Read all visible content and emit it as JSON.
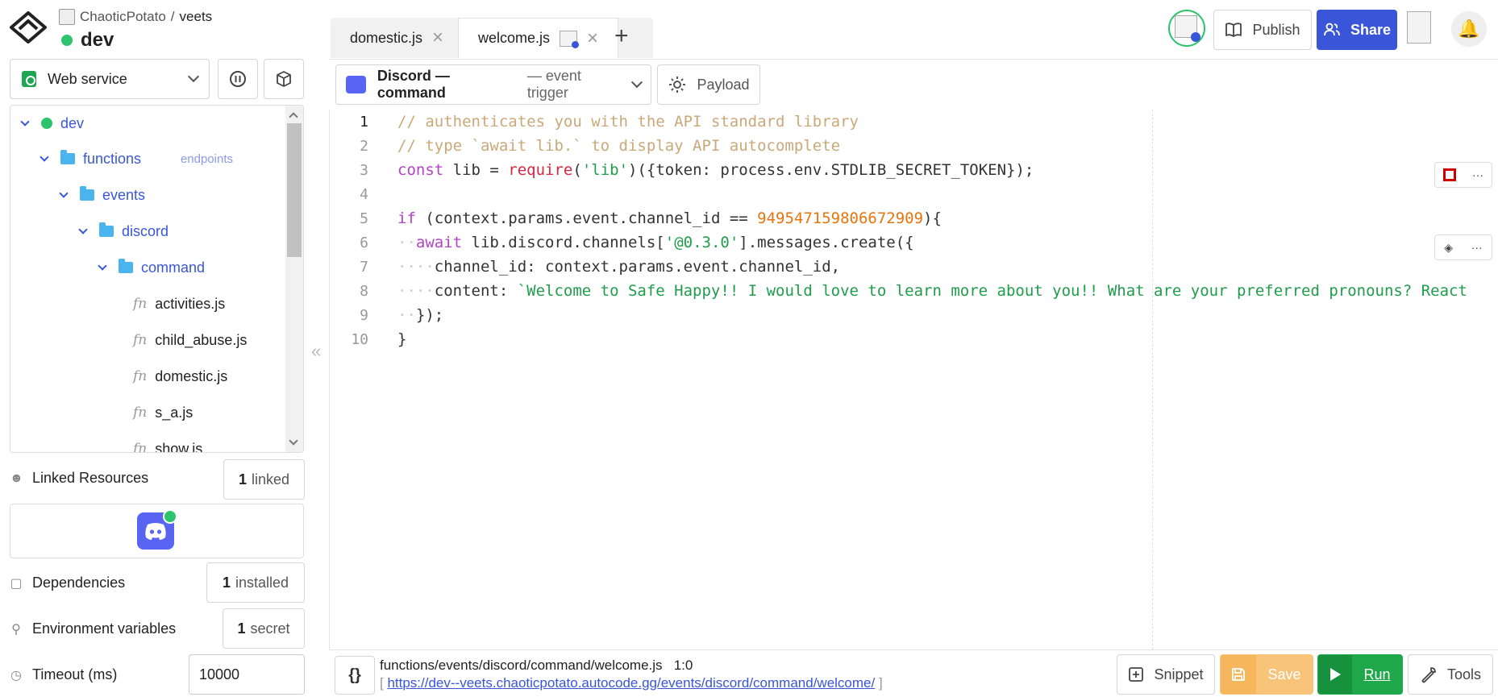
{
  "header": {
    "owner": "ChaoticPotato",
    "slash": "/",
    "project": "veets",
    "environment": "dev"
  },
  "service_select": {
    "value": "Web service"
  },
  "tree": {
    "items": [
      {
        "label": "dev",
        "type": "env"
      },
      {
        "label": "functions",
        "type": "folder",
        "badge": "endpoints"
      },
      {
        "label": "events",
        "type": "folder"
      },
      {
        "label": "discord",
        "type": "folder"
      },
      {
        "label": "command",
        "type": "folder"
      },
      {
        "label": "activities.js",
        "type": "file"
      },
      {
        "label": "child_abuse.js",
        "type": "file"
      },
      {
        "label": "domestic.js",
        "type": "file"
      },
      {
        "label": "s_a.js",
        "type": "file"
      },
      {
        "label": "show.js",
        "type": "file"
      }
    ],
    "fn_glyph": "fn"
  },
  "linked_resources": {
    "label": "Linked Resources",
    "count": "1",
    "unit": "linked"
  },
  "dependencies": {
    "label": "Dependencies",
    "count": "1",
    "unit": "installed"
  },
  "env_vars": {
    "label": "Environment variables",
    "count": "1",
    "unit": "secret"
  },
  "timeout": {
    "label": "Timeout (ms)",
    "value": "10000"
  },
  "tabs": [
    {
      "label": "domestic.js",
      "active": false
    },
    {
      "label": "welcome.js",
      "active": true
    }
  ],
  "topbar": {
    "publish": "Publish",
    "share": "Share"
  },
  "trigger": {
    "name": "Discord — command",
    "sub": "— event trigger"
  },
  "payload": {
    "label": "Payload"
  },
  "code": {
    "line_numbers": [
      "1",
      "2",
      "3",
      "4",
      "5",
      "6",
      "7",
      "8",
      "9",
      "10"
    ],
    "l1": "// authenticates you with the API standard library",
    "l2": "// type `await lib.` to display API autocomplete",
    "l3_kw": "const",
    "l3_a": " lib = ",
    "l3_fn": "require",
    "l3_b": "(",
    "l3_str": "'lib'",
    "l3_c": ")({token: process.env.STDLIB_SECRET_TOKEN});",
    "l5_kw": "if",
    "l5_a": " (context.params.event.channel_id == ",
    "l5_num": "949547159806672909",
    "l5_b": "){",
    "l6_dots": "··",
    "l6_kw": "await",
    "l6_a": " lib.discord.channels[",
    "l6_str": "'@0.3.0'",
    "l6_b": "].messages.create({",
    "l7_dots": "····",
    "l7_a": "channel_id: context.params.event.channel_id,",
    "l8_dots": "····",
    "l8_a": "content: ",
    "l8_str": "`Welcome to Safe Happy!! I would love to learn more about you!! What are your preferred pronouns? React",
    "l9_dots": "··",
    "l9_a": "});",
    "l10_a": "}"
  },
  "status": {
    "path": "functions/events/discord/command/welcome.js",
    "cursor": "1:0",
    "url_open": "[ ",
    "url": "https://dev--veets.chaoticpotato.autocode.gg/events/discord/command/welcome/",
    "url_close": " ]",
    "braces": "{}"
  },
  "actions": {
    "snippet": "Snippet",
    "save": "Save",
    "run": "Run",
    "tools": "Tools"
  },
  "colors": {
    "accent": "#3a56d8",
    "green": "#1ea84a",
    "discord": "#5865f2",
    "save": "#f8c47a"
  }
}
